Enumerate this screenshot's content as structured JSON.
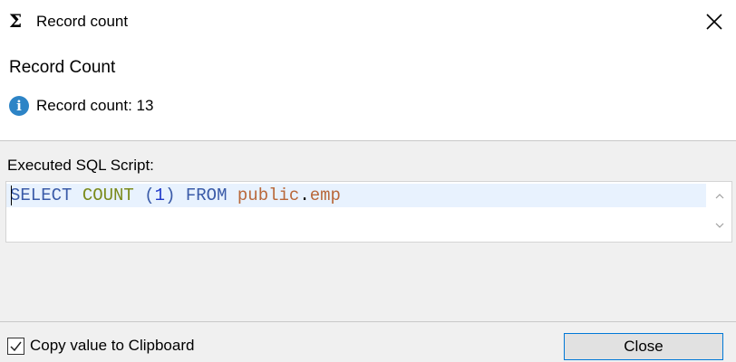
{
  "window": {
    "title": "Record count",
    "title_icon": "sigma-icon",
    "title_icon_glyph": "Σ",
    "close_icon": "close-icon"
  },
  "header": {
    "heading": "Record Count",
    "info_icon": "info-icon",
    "info_glyph": "i",
    "info_text": "Record count: 13"
  },
  "sql": {
    "label": "Executed SQL Script:",
    "tokens": {
      "select": "SELECT",
      "count": "COUNT",
      "paren_open": "(",
      "one": "1",
      "paren_close": ")",
      "from": "FROM",
      "schema": "public",
      "dot": ".",
      "table": "emp"
    },
    "colors": {
      "keyword": "#3a5ba8",
      "function": "#7a8a1a",
      "number": "#1d37c9",
      "identifier": "#b9683a",
      "current_line": "#e8f2fe"
    }
  },
  "footer": {
    "checkbox_label": "Copy value to Clipboard",
    "checkbox_checked": true,
    "close_label": "Close"
  },
  "colors": {
    "accent": "#0078d7",
    "info": "#2d84c6",
    "panel_bg": "#f0f0f0"
  }
}
